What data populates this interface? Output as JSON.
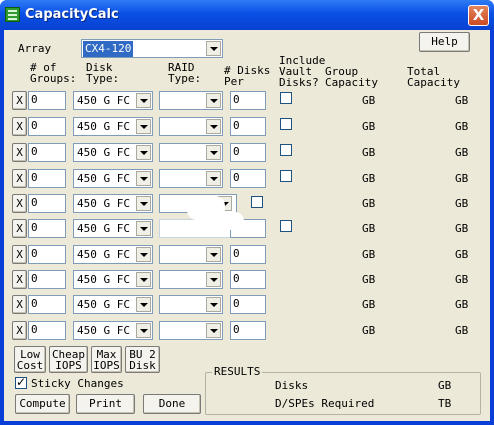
{
  "window": {
    "title": "CapacityCalc",
    "close_label": "X"
  },
  "top": {
    "array_label": "Array",
    "array_value": "CX4-120",
    "help_label": "Help"
  },
  "headers": {
    "groups": "# of\nGroups:",
    "disk_type": "Disk\nType:",
    "raid_type": "RAID\nType:",
    "disks_per": "# Disks\nPer",
    "include_vault": "Include\nVault\nDisks?",
    "group_capacity": "Group\nCapacity",
    "total_capacity": "Total\nCapacity"
  },
  "rows": [
    {
      "x": "X",
      "groups": "0",
      "disk_type": "450 G FC",
      "raid_type": "",
      "disks_per": "0",
      "vault_checkbox": true,
      "group_unit": "GB",
      "total_unit": "GB"
    },
    {
      "x": "X",
      "groups": "0",
      "disk_type": "450 G FC",
      "raid_type": "",
      "disks_per": "0",
      "vault_checkbox": true,
      "group_unit": "GB",
      "total_unit": "GB"
    },
    {
      "x": "X",
      "groups": "0",
      "disk_type": "450 G FC",
      "raid_type": "",
      "disks_per": "0",
      "vault_checkbox": true,
      "group_unit": "GB",
      "total_unit": "GB"
    },
    {
      "x": "X",
      "groups": "0",
      "disk_type": "450 G FC",
      "raid_type": "",
      "disks_per": "0",
      "vault_checkbox": true,
      "group_unit": "GB",
      "total_unit": "GB"
    },
    {
      "x": "X",
      "groups": "0",
      "disk_type": "450 G FC",
      "raid_type": "",
      "disks_per": "",
      "vault_checkbox": true,
      "group_unit": "GB",
      "total_unit": "GB"
    },
    {
      "x": "X",
      "groups": "0",
      "disk_type": "450 G FC",
      "raid_type": "",
      "disks_per": "",
      "vault_checkbox": true,
      "group_unit": "GB",
      "total_unit": "GB"
    },
    {
      "x": "X",
      "groups": "0",
      "disk_type": "450 G FC",
      "raid_type": "",
      "disks_per": "0",
      "vault_checkbox": false,
      "group_unit": "GB",
      "total_unit": "GB"
    },
    {
      "x": "X",
      "groups": "0",
      "disk_type": "450 G FC",
      "raid_type": "",
      "disks_per": "0",
      "vault_checkbox": false,
      "group_unit": "GB",
      "total_unit": "GB"
    },
    {
      "x": "X",
      "groups": "0",
      "disk_type": "450 G FC",
      "raid_type": "",
      "disks_per": "0",
      "vault_checkbox": false,
      "group_unit": "GB",
      "total_unit": "GB"
    },
    {
      "x": "X",
      "groups": "0",
      "disk_type": "450 G FC",
      "raid_type": "",
      "disks_per": "0",
      "vault_checkbox": false,
      "group_unit": "GB",
      "total_unit": "GB"
    }
  ],
  "presets": [
    {
      "line1": "Low",
      "line2": "Cost"
    },
    {
      "line1": "Cheap",
      "line2": "IOPS"
    },
    {
      "line1": "Max",
      "line2": "IOPS"
    },
    {
      "line1": "BU 2",
      "line2": "Disk"
    }
  ],
  "sticky": {
    "label": "Sticky Changes",
    "checked": true
  },
  "buttons": {
    "compute": "Compute",
    "print": "Print",
    "done": "Done"
  },
  "results": {
    "title": "RESULTS",
    "disks_label": "Disks",
    "disks_unit": "GB",
    "dspe_label": "D/SPEs Required",
    "dspe_unit": "TB"
  }
}
